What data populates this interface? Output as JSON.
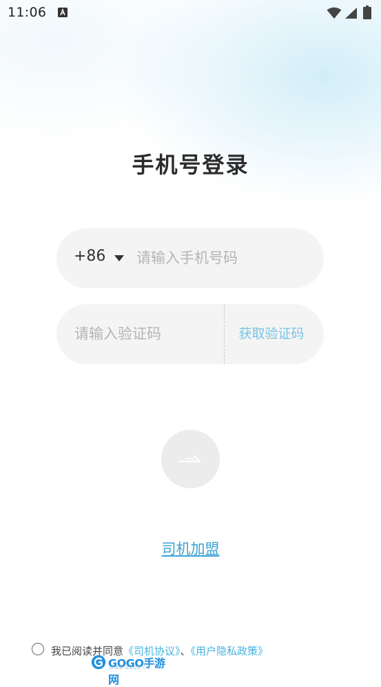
{
  "status_bar": {
    "time": "11:06",
    "notification_icon": "accessibility-a-icon",
    "wifi_icon": "wifi-icon",
    "signal_icon": "cell-signal-icon",
    "battery_icon": "battery-icon"
  },
  "page": {
    "title": "手机号登录"
  },
  "phone_field": {
    "country_code": "+86",
    "placeholder": "请输入手机号码",
    "value": ""
  },
  "code_field": {
    "placeholder": "请输入验证码",
    "value": "",
    "get_code_label": "获取验证码"
  },
  "submit": {
    "icon": "arrow-right-icon"
  },
  "join": {
    "label": "司机加盟"
  },
  "agreement": {
    "prefix": "我已阅读并同意",
    "driver_agreement": "《司机协议》",
    "separator": "、",
    "privacy_policy": "《用户隐私政策》",
    "checked": false
  },
  "watermark": {
    "brand": "GOGO手游网",
    "url": "WWW.GOGO.CN"
  },
  "colors": {
    "accent": "#46b3e2",
    "link": "#3aa2d4",
    "field_bg": "#f4f4f4",
    "placeholder": "#b5b5b5"
  }
}
